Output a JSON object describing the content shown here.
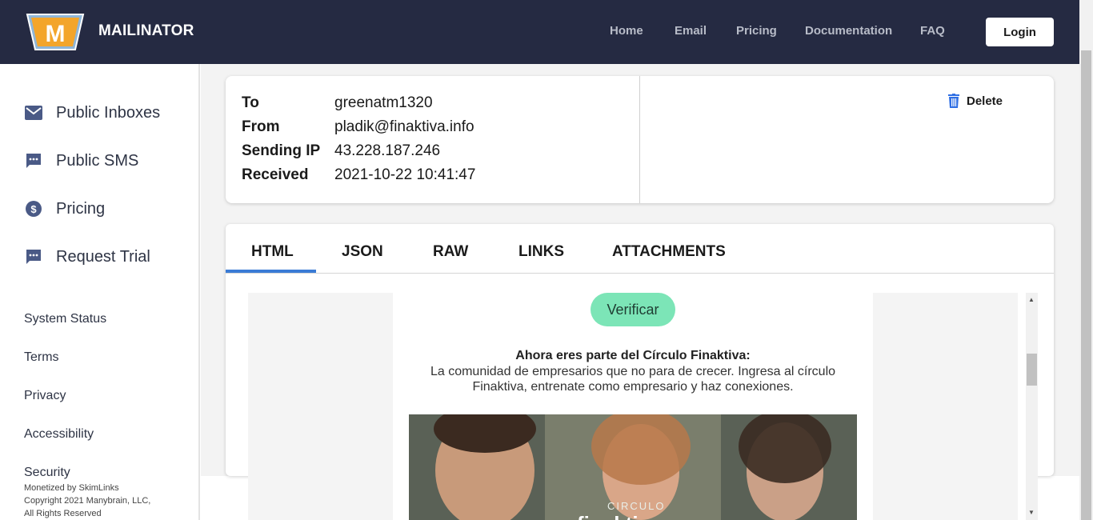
{
  "header": {
    "brand": "MAILINATOR",
    "logo_letter": "M",
    "nav": [
      "Home",
      "Email",
      "Pricing",
      "Documentation",
      "FAQ"
    ],
    "login_label": "Login"
  },
  "sidebar": {
    "items": [
      {
        "label": "Public Inboxes",
        "icon": "mail-icon"
      },
      {
        "label": "Public SMS",
        "icon": "sms-icon"
      },
      {
        "label": "Pricing",
        "icon": "dollar-icon"
      },
      {
        "label": "Request Trial",
        "icon": "chat-icon"
      }
    ],
    "links": [
      "System Status",
      "Terms",
      "Privacy",
      "Accessibility",
      "Security"
    ],
    "footer": [
      "Monetized by SkimLinks",
      "Copyright 2021 Manybrain, LLC,",
      "All Rights Reserved"
    ]
  },
  "message": {
    "fields": [
      {
        "key": "To",
        "value": "greenatm1320"
      },
      {
        "key": "From",
        "value": "pladik@finaktiva.info"
      },
      {
        "key": "Sending IP",
        "value": "43.228.187.246"
      },
      {
        "key": "Received",
        "value": "2021-10-22 10:41:47"
      }
    ],
    "delete_label": "Delete"
  },
  "tabs": [
    "HTML",
    "JSON",
    "RAW",
    "LINKS",
    "ATTACHMENTS"
  ],
  "active_tab": "HTML",
  "email": {
    "button_label": "Verificar",
    "heading": "Ahora eres parte del Círculo Finaktiva:",
    "text": "La comunidad de empresarios que no para de crecer. Ingresa al círculo Finaktiva, entrenate como empresario y haz conexiones.",
    "photo_caption": "CIRCULO",
    "photo_brand": "finaktiva"
  },
  "colors": {
    "header_bg": "#252a42",
    "accent": "#3a7bd5",
    "verify_bg": "#7ce5b7",
    "delete_icon": "#2f6fe4",
    "sidebar_icon": "#4a5a86"
  }
}
